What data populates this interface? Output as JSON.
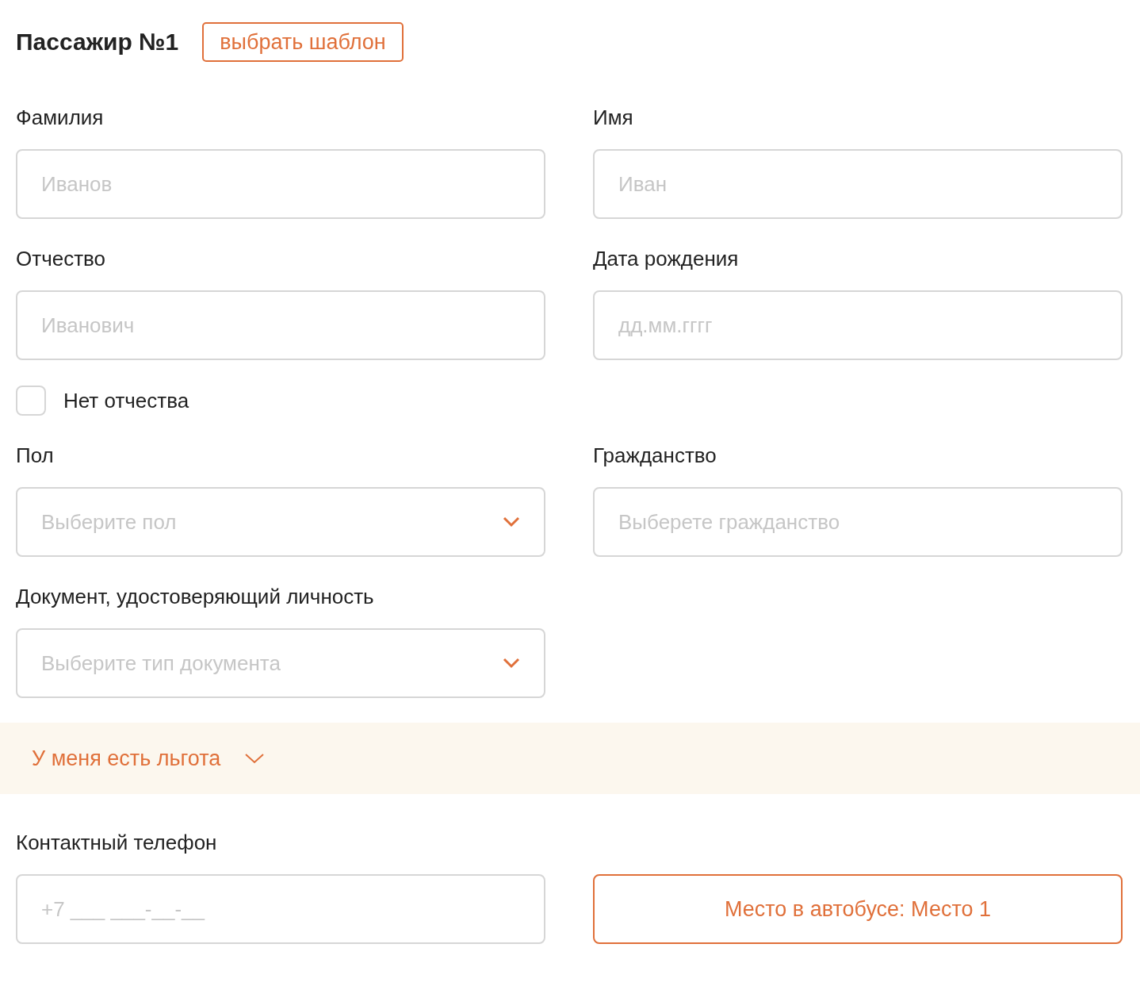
{
  "header": {
    "title": "Пассажир №1",
    "template_button": "выбрать шаблон"
  },
  "rows": [
    [
      {
        "kind": "text",
        "label": "Фамилия",
        "placeholder": "Иванов"
      },
      {
        "kind": "text",
        "label": "Имя",
        "placeholder": "Иван"
      }
    ],
    [
      {
        "kind": "text",
        "label": "Отчество",
        "placeholder": "Иванович"
      },
      {
        "kind": "text",
        "label": "Дата рождения",
        "placeholder": "дд.мм.гггг"
      }
    ],
    [
      {
        "kind": "checkbox",
        "label": "Нет отчества",
        "checked": false
      }
    ],
    [
      {
        "kind": "select",
        "label": "Пол",
        "placeholder": "Выберите пол"
      },
      {
        "kind": "text",
        "label": "Гражданство",
        "placeholder": "Выберете гражданство"
      }
    ],
    [
      {
        "kind": "select",
        "label": "Документ, удостоверяющий личность",
        "placeholder": "Выберите тип документа"
      }
    ]
  ],
  "benefit": {
    "label": "У меня есть льгота",
    "expanded": false
  },
  "contact": {
    "label": "Контактный телефон",
    "placeholder": "+7 ___ ___-__-__",
    "seat_button": "Место в автобусе: Место 1"
  }
}
